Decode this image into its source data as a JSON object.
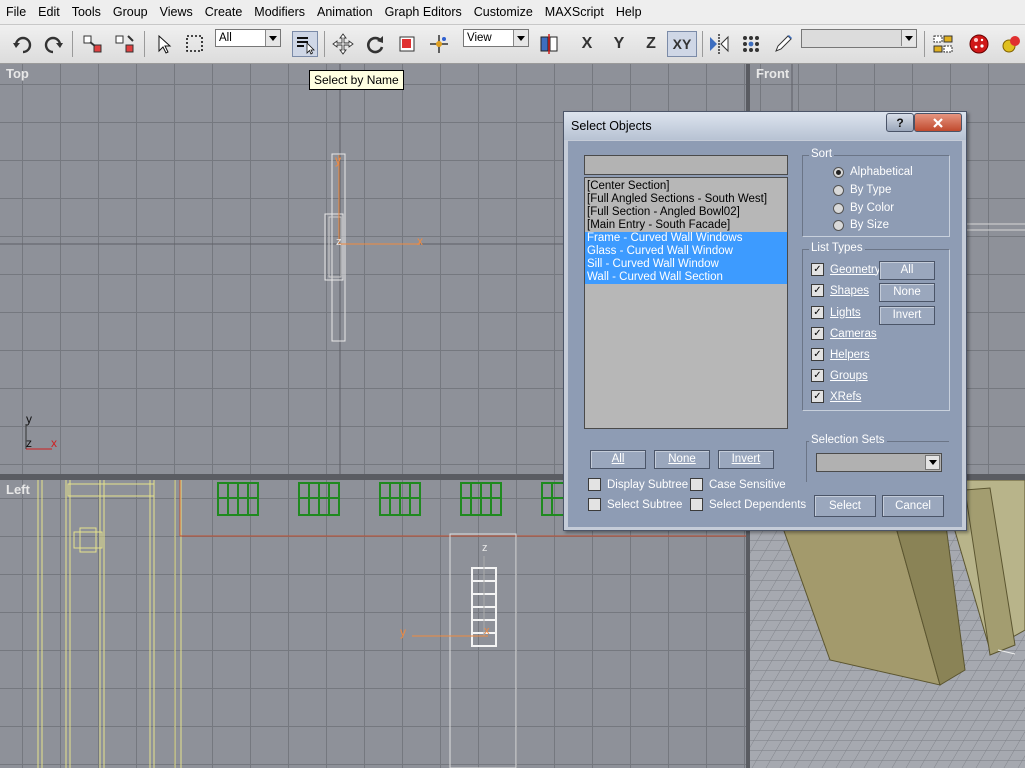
{
  "menu": [
    "File",
    "Edit",
    "Tools",
    "Group",
    "Views",
    "Create",
    "Modifiers",
    "Animation",
    "Graph Editors",
    "Customize",
    "MAXScript",
    "Help"
  ],
  "toolbar": {
    "filter_value": "All",
    "coord_value": "View",
    "constraints": [
      "X",
      "Y",
      "Z",
      "XY"
    ],
    "named_sel_value": ""
  },
  "tooltip": "Select by Name",
  "viewports": {
    "top": "Top",
    "front": "Front",
    "left": "Left",
    "axis_x": "x",
    "axis_y": "y",
    "axis_z": "z"
  },
  "dialog": {
    "title": "Select Objects",
    "help": "?",
    "search_value": "",
    "objects": [
      {
        "name": "[Center Section]",
        "selected": false
      },
      {
        "name": "[Full Angled Sections - South West]",
        "selected": false
      },
      {
        "name": "[Full Section - Angled Bowl02]",
        "selected": false
      },
      {
        "name": "[Main Entry - South Facade]",
        "selected": false
      },
      {
        "name": "Frame - Curved Wall Windows",
        "selected": true
      },
      {
        "name": "Glass - Curved Wall Window",
        "selected": true
      },
      {
        "name": "Sill - Curved Wall Window",
        "selected": true
      },
      {
        "name": "Wall - Curved Wall Section",
        "selected": true
      }
    ],
    "sort": {
      "title": "Sort",
      "options": [
        "Alphabetical",
        "By Type",
        "By Color",
        "By Size"
      ],
      "selected": "Alphabetical"
    },
    "list_types": {
      "title": "List Types",
      "items": [
        "Geometry",
        "Shapes",
        "Lights",
        "Cameras",
        "Helpers",
        "Groups",
        "XRefs"
      ],
      "buttons": [
        "All",
        "None",
        "Invert"
      ]
    },
    "list_buttons": [
      "All",
      "None",
      "Invert"
    ],
    "options": {
      "display_subtree": "Display Subtree",
      "case_sensitive": "Case Sensitive",
      "select_subtree": "Select Subtree",
      "select_dependents": "Select Dependents"
    },
    "selection_sets": {
      "title": "Selection Sets",
      "value": ""
    },
    "select_label": "Select",
    "cancel_label": "Cancel"
  },
  "colors": {
    "selection": "#3d9bff",
    "viewport": "#8e9199",
    "dialog_body": "#8e9cb4",
    "window_green": "#1f8a1f"
  }
}
